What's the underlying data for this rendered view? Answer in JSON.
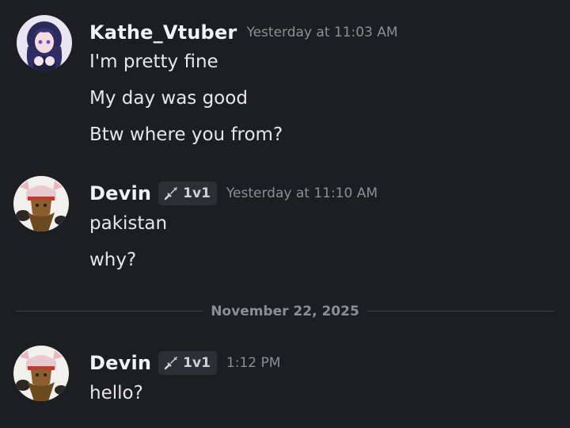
{
  "messages": [
    {
      "author": "Kathe_Vtuber",
      "timestamp": "Yesterday at 11:03 AM",
      "lines": [
        "I'm pretty fine",
        "My day was good",
        "Btw where you from?"
      ]
    },
    {
      "author": "Devin",
      "tag": {
        "icon": "sword-icon",
        "label": "1v1"
      },
      "timestamp": "Yesterday at 11:10 AM",
      "lines": [
        "pakistan",
        "why?"
      ]
    },
    {
      "author": "Devin",
      "tag": {
        "icon": "sword-icon",
        "label": "1v1"
      },
      "timestamp": "1:12 PM",
      "lines": [
        "hello?"
      ]
    }
  ],
  "date_divider": "November 22, 2025",
  "colors": {
    "background": "#1d1e22",
    "text": "#e6e7ea",
    "muted": "#8b8e96",
    "tag_bg": "#2d2f35"
  }
}
